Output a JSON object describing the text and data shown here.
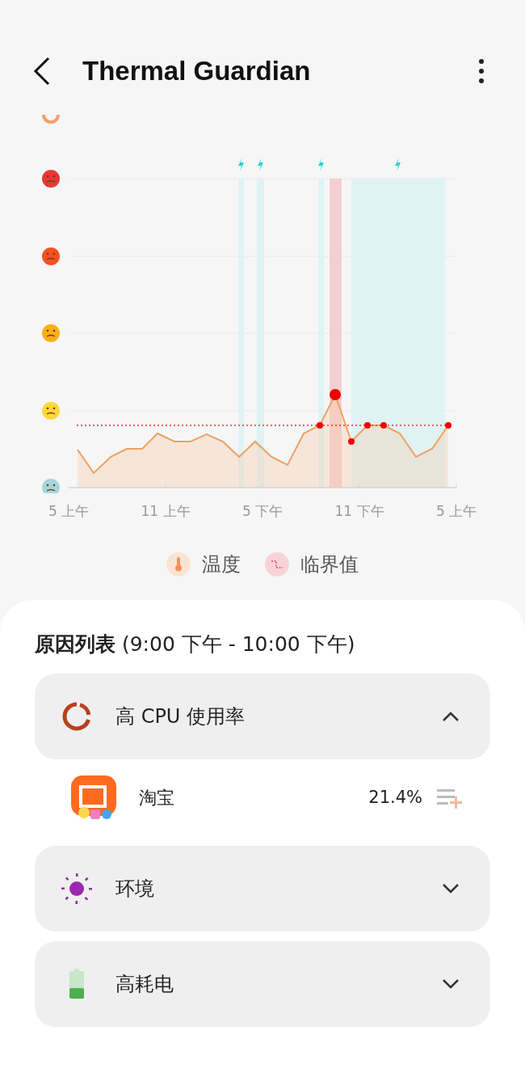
{
  "header": {
    "title": "Thermal Guardian"
  },
  "chart": {
    "x_labels": [
      "5 上午",
      "11 上午",
      "5 下午",
      "11 下午",
      "5 上午"
    ]
  },
  "legend": [
    {
      "kind": "temperature",
      "label": "温度"
    },
    {
      "kind": "threshold",
      "label": "临界值"
    }
  ],
  "causes": {
    "title": "原因列表",
    "range": "(9:00 下午 - 10:00 下午)",
    "items": [
      {
        "kind": "cpu",
        "label": "高 CPU 使用率",
        "expanded": true,
        "apps": [
          {
            "name": "淘宝",
            "value": "21.4%"
          }
        ]
      },
      {
        "kind": "environment",
        "label": "环境",
        "expanded": false
      },
      {
        "kind": "battery",
        "label": "高耗电",
        "expanded": false
      }
    ]
  }
}
